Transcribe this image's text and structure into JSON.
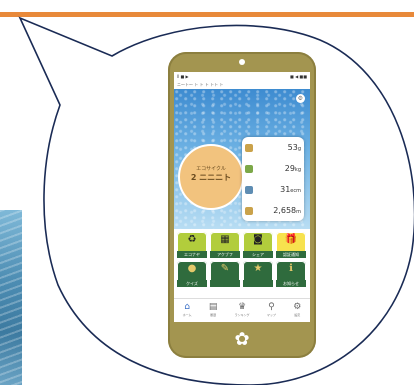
{
  "status": {
    "left": "ll ■ ▶",
    "right": "■ ◀ ■■"
  },
  "header": {
    "subtitle": "ニ～ト～ ト ト ト トト ト"
  },
  "circle": {
    "line1": "エコサイクル",
    "line2": "2 ニニニト"
  },
  "stats": [
    {
      "value": "53",
      "unit": "g"
    },
    {
      "value": "29",
      "unit": "kg"
    },
    {
      "value": "31",
      "unit": "ecm"
    },
    {
      "value": "2,658",
      "unit": "m"
    }
  ],
  "tiles": [
    {
      "label": "エコナヤ",
      "glyph": "♻",
      "style": "green"
    },
    {
      "label": "アクブフ",
      "glyph": "▦",
      "style": "green"
    },
    {
      "label": "シェア",
      "glyph": "◙",
      "style": "green"
    },
    {
      "label": "認証通知",
      "glyph": "🎁",
      "style": "gold"
    },
    {
      "label": "クイズ",
      "glyph": "●",
      "style": "dark"
    },
    {
      "label": "",
      "glyph": "✎",
      "style": "dark"
    },
    {
      "label": "",
      "glyph": "★",
      "style": "dark"
    },
    {
      "label": "お知らせ",
      "glyph": "ℹ",
      "style": "dark"
    }
  ],
  "tabs": [
    {
      "label": "ホーム",
      "glyph": "⌂"
    },
    {
      "label": "履歴",
      "glyph": "▤"
    },
    {
      "label": "ランキング",
      "glyph": "♛"
    },
    {
      "label": "マップ",
      "glyph": "⚲"
    },
    {
      "label": "設定",
      "glyph": "⚙"
    }
  ],
  "colors": {
    "accent": "#e8893a",
    "phone": "#a39550",
    "tile_green": "#b2cd3c",
    "tile_dark": "#2f6b3d"
  }
}
